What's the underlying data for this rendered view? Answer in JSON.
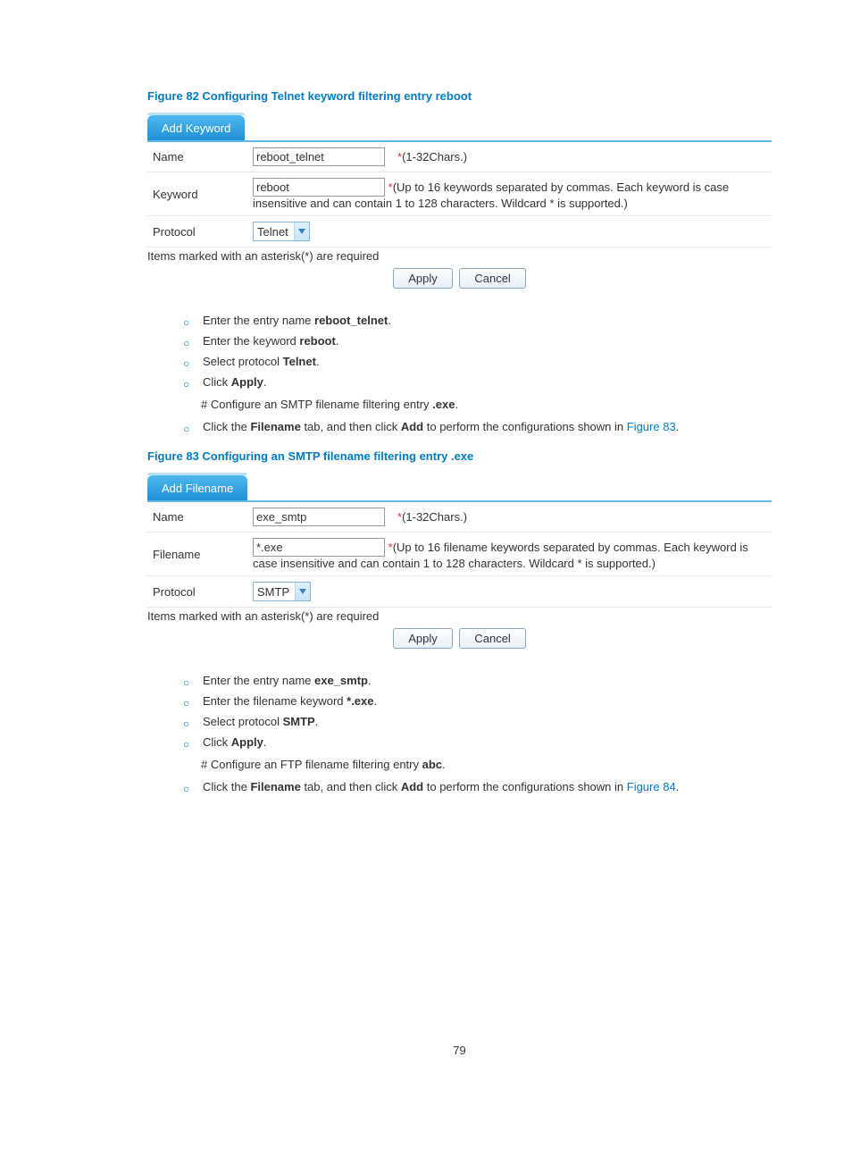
{
  "figure82": {
    "title": "Figure 82 Configuring Telnet keyword filtering entry reboot",
    "tab_label": "Add Keyword",
    "rows": {
      "name": {
        "label": "Name",
        "value": "reboot_telnet",
        "hint": "(1-32Chars.)"
      },
      "keyword": {
        "label": "Keyword",
        "value": "reboot",
        "hint": "(Up to 16 keywords separated by commas. Each keyword is case insensitive and can contain 1 to 128 characters. Wildcard * is supported.)"
      },
      "protocol": {
        "label": "Protocol",
        "value": "Telnet"
      }
    },
    "required_note": "Items marked with an asterisk(*) are required",
    "buttons": {
      "apply": "Apply",
      "cancel": "Cancel"
    }
  },
  "instructions1": {
    "i1": {
      "pre": "Enter the entry name ",
      "bold": "reboot_telnet",
      "post": "."
    },
    "i2": {
      "pre": "Enter the keyword ",
      "bold": "reboot",
      "post": "."
    },
    "i3": {
      "pre": "Select protocol ",
      "bold": "Telnet",
      "post": "."
    },
    "i4": {
      "pre": "Click ",
      "bold": "Apply",
      "post": "."
    },
    "hash": {
      "pre": "# Configure an SMTP filename filtering entry ",
      "bold": ".exe",
      "post": "."
    },
    "i5": {
      "pre": "Click the ",
      "bold1": "Filename",
      "mid": " tab, and then click ",
      "bold2": "Add",
      "post": " to perform the configurations shown in ",
      "link": "Figure 83",
      "post2": "."
    }
  },
  "figure83": {
    "title": "Figure 83 Configuring an SMTP filename filtering entry .exe",
    "tab_label": "Add Filename",
    "rows": {
      "name": {
        "label": "Name",
        "value": "exe_smtp",
        "hint": "(1-32Chars.)"
      },
      "filename": {
        "label": "Filename",
        "value": "*.exe",
        "hint": "(Up to 16 filename keywords separated by commas. Each keyword is case insensitive and can contain 1 to 128 characters. Wildcard * is supported.)"
      },
      "protocol": {
        "label": "Protocol",
        "value": "SMTP"
      }
    },
    "required_note": "Items marked with an asterisk(*) are required",
    "buttons": {
      "apply": "Apply",
      "cancel": "Cancel"
    }
  },
  "instructions2": {
    "i1": {
      "pre": "Enter the entry name ",
      "bold": "exe_smtp",
      "post": "."
    },
    "i2": {
      "pre": "Enter the filename keyword ",
      "bold": "*.exe",
      "post": "."
    },
    "i3": {
      "pre": "Select protocol ",
      "bold": "SMTP",
      "post": "."
    },
    "i4": {
      "pre": "Click ",
      "bold": "Apply",
      "post": "."
    },
    "hash": {
      "pre": "# Configure an FTP filename filtering entry ",
      "bold": "abc",
      "post": "."
    },
    "i5": {
      "pre": "Click the ",
      "bold1": "Filename",
      "mid": " tab, and then click ",
      "bold2": "Add",
      "post": " to perform the configurations shown in ",
      "link": "Figure 84",
      "post2": "."
    }
  },
  "page_number": "79",
  "asterisk": "*"
}
